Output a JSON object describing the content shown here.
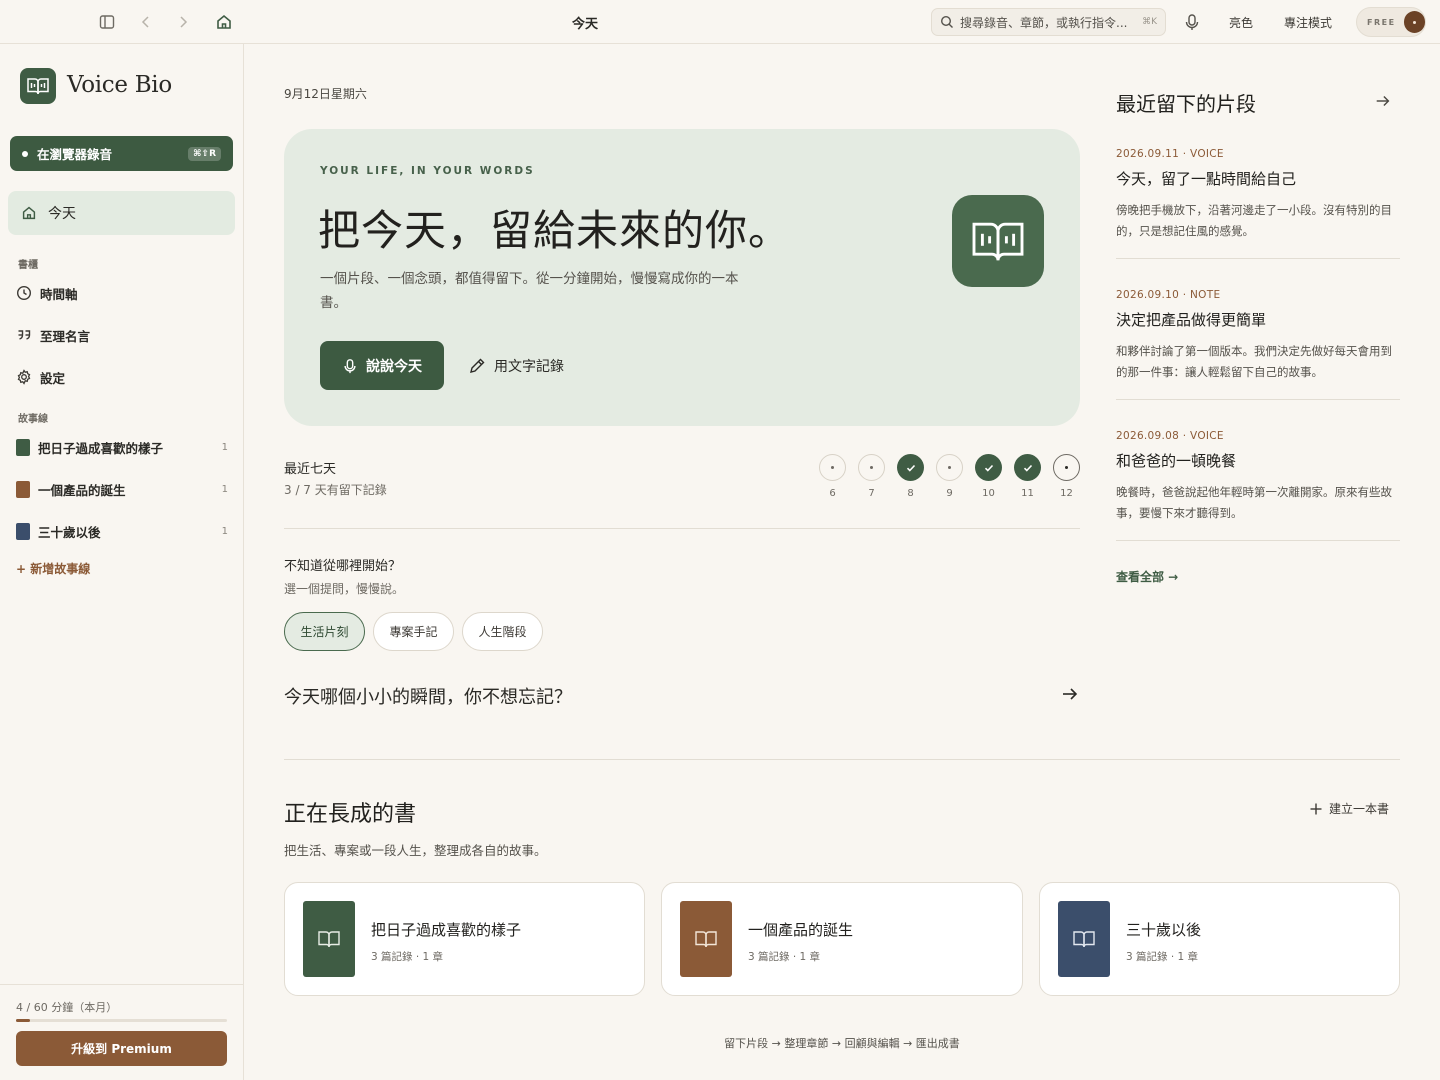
{
  "topbar": {
    "title": "今天",
    "search_placeholder": "搜尋錄音、章節，或執行指令...",
    "search_shortcut": "⌘K",
    "theme_label": "亮色",
    "focus_label": "專注模式",
    "plan_badge": "FREE"
  },
  "sidebar": {
    "brand": "Voice Bio",
    "record_button": "在瀏覽器錄音",
    "record_shortcut": "⌘⇧R",
    "today": "今天",
    "section_books": "書櫃",
    "nav": [
      {
        "label": "時間軸",
        "icon": "clock-icon"
      },
      {
        "label": "至理名言",
        "icon": "quote-icon"
      },
      {
        "label": "設定",
        "icon": "gear-icon"
      }
    ],
    "section_stories": "故事線",
    "stories": [
      {
        "label": "把日子過成喜歡的樣子",
        "count": "1",
        "color": "#3f5c44"
      },
      {
        "label": "一個產品的誕生",
        "count": "1",
        "color": "#8b5a37"
      },
      {
        "label": "三十歲以後",
        "count": "1",
        "color": "#3b4e6b"
      }
    ],
    "add_story": "+ 新增故事線",
    "usage_text": "4 / 60 分鐘（本月）",
    "usage_fraction": 0.067,
    "upgrade": "升級到 Premium"
  },
  "main": {
    "date": "9月12日星期六",
    "hero": {
      "eyebrow": "YOUR LIFE, IN YOUR WORDS",
      "headline": "把今天，留給未來的你。",
      "subtext": "一個片段、一個念頭，都值得留下。從一分鐘開始，慢慢寫成你的一本書。",
      "speak_button": "說說今天",
      "write_button": "用文字記錄"
    },
    "week": {
      "title": "最近七天",
      "summary": "3 / 7 天有留下記錄",
      "days": [
        {
          "day": "6",
          "state": "empty"
        },
        {
          "day": "7",
          "state": "empty"
        },
        {
          "day": "8",
          "state": "done"
        },
        {
          "day": "9",
          "state": "empty"
        },
        {
          "day": "10",
          "state": "done"
        },
        {
          "day": "11",
          "state": "done"
        },
        {
          "day": "12",
          "state": "today"
        }
      ]
    },
    "prompts": {
      "title": "不知道從哪裡開始？",
      "subtitle": "選一個提問，慢慢說。",
      "chips": [
        "生活片刻",
        "專案手記",
        "人生階段"
      ],
      "active_chip": "生活片刻",
      "question": "今天哪個小小的瞬間，你不想忘記？"
    },
    "books": {
      "title": "正在長成的書",
      "subtitle": "把生活、專案或一段人生，整理成各自的故事。",
      "new_book": "建立一本書",
      "items": [
        {
          "name": "把日子過成喜歡的樣子",
          "meta": "3 篇記錄 · 1 章",
          "color": "#3f5c44"
        },
        {
          "name": "一個產品的誕生",
          "meta": "3 篇記錄 · 1 章",
          "color": "#8b5a37"
        },
        {
          "name": "三十歲以後",
          "meta": "3 篇記錄 · 1 章",
          "color": "#3b4e6b"
        }
      ]
    },
    "flow": "留下片段 → 整理章節 → 回顧與編輯 → 匯出成書"
  },
  "recent": {
    "title": "最近留下的片段",
    "entries": [
      {
        "meta": "2026.09.11 · VOICE",
        "title": "今天，留了一點時間給自己",
        "body": "傍晚把手機放下，沿著河邊走了一小段。沒有特別的目的，只是想記住風的感覺。"
      },
      {
        "meta": "2026.09.10 · NOTE",
        "title": "決定把產品做得更簡單",
        "body": "和夥伴討論了第一個版本。我們決定先做好每天會用到的那一件事：讓人輕鬆留下自己的故事。"
      },
      {
        "meta": "2026.09.08 · VOICE",
        "title": "和爸爸的一頓晚餐",
        "body": "晚餐時，爸爸說起他年輕時第一次離開家。原來有些故事，要慢下來才聽得到。"
      }
    ],
    "see_all": "查看全部 →"
  }
}
